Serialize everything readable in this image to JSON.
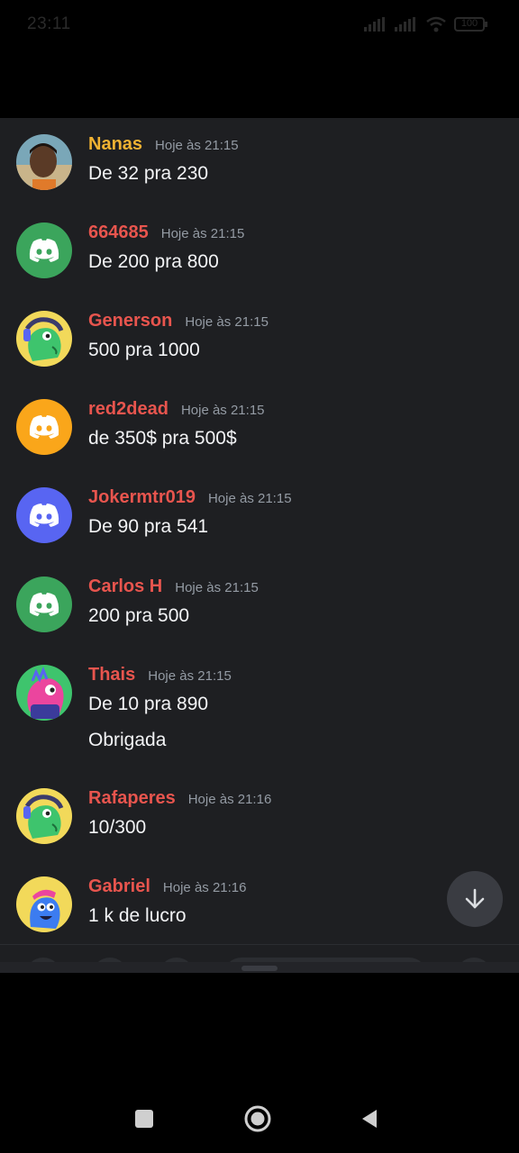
{
  "status_bar": {
    "time": "23:11",
    "battery": "100"
  },
  "messages": [
    {
      "username": "Nanas",
      "name_color": "#f0b232",
      "time": "Hoje às 21:15",
      "lines": [
        "De 32 pra 230"
      ],
      "avatar": "photo"
    },
    {
      "username": "664685",
      "name_color": "#e8554e",
      "time": "Hoje às 21:15",
      "lines": [
        "De 200 pra 800"
      ],
      "avatar": "discord-green"
    },
    {
      "username": "Generson",
      "name_color": "#e8554e",
      "time": "Hoje às 21:15",
      "lines": [
        "500 pra 1000"
      ],
      "avatar": "mascot-green"
    },
    {
      "username": "red2dead",
      "name_color": "#e8554e",
      "time": "Hoje às 21:15",
      "lines": [
        "de 350$ pra 500$"
      ],
      "avatar": "discord-orange"
    },
    {
      "username": "Jokermtr019",
      "name_color": "#e8554e",
      "time": "Hoje às 21:15",
      "lines": [
        "De 90 pra 541"
      ],
      "avatar": "discord-blurple"
    },
    {
      "username": "Carlos H",
      "name_color": "#e8554e",
      "time": "Hoje às 21:15",
      "lines": [
        "200 pra 500"
      ],
      "avatar": "discord-green"
    },
    {
      "username": "Thais",
      "name_color": "#e8554e",
      "time": "Hoje às 21:15",
      "lines": [
        "De 10 pra 890",
        "Obrigada"
      ],
      "avatar": "mascot-pink"
    },
    {
      "username": "Rafaperes",
      "name_color": "#e8554e",
      "time": "Hoje às 21:16",
      "lines": [
        "10/300"
      ],
      "avatar": "mascot-green"
    },
    {
      "username": "Gabriel",
      "name_color": "#e8554e",
      "time": "Hoje às 21:16",
      "lines": [
        "1 k de lucro"
      ],
      "avatar": "mascot-blue"
    }
  ],
  "icons": {
    "scroll_down": "arrow-down-icon",
    "nav_recents": "square-icon",
    "nav_home": "circle-icon",
    "nav_back": "triangle-back-icon"
  },
  "colors": {
    "background": "#1e1f22",
    "discord_green": "#3ba55c",
    "discord_orange": "#faa61a",
    "discord_blurple": "#5865f2"
  }
}
